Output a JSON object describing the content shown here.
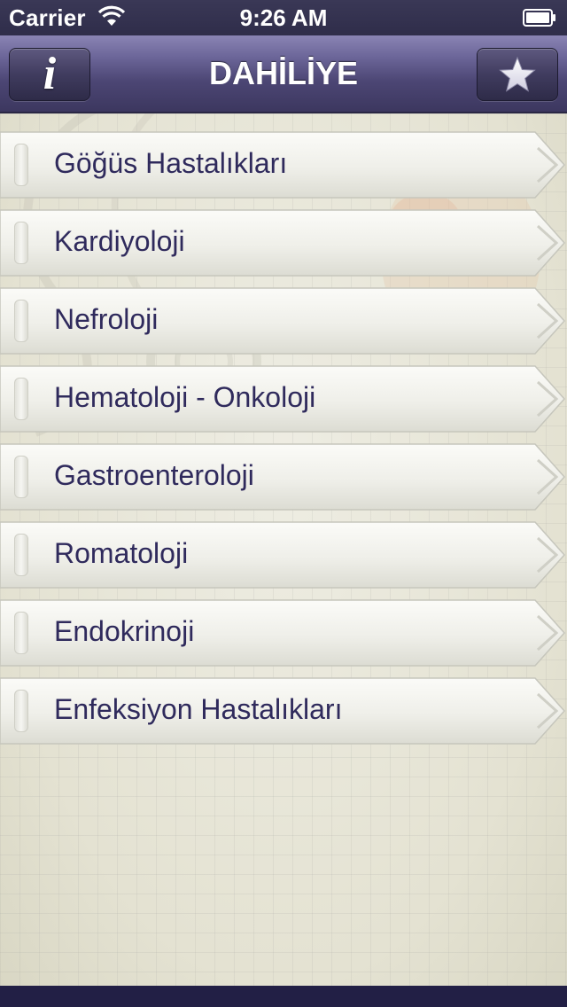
{
  "status_bar": {
    "carrier": "Carrier",
    "time": "9:26 AM",
    "wifi_icon": "wifi-icon",
    "battery_icon": "battery-icon"
  },
  "nav_bar": {
    "title": "DAHİLİYE",
    "info_button_glyph": "i",
    "info_icon": "info-icon",
    "favorites_icon": "star-icon"
  },
  "menu": {
    "items": [
      {
        "label": "Göğüs Hastalıkları"
      },
      {
        "label": "Kardiyoloji"
      },
      {
        "label": "Nefroloji"
      },
      {
        "label": "Hematoloji - Onkoloji"
      },
      {
        "label": "Gastroenteroloji"
      },
      {
        "label": "Romatoloji"
      },
      {
        "label": "Endokrinoji"
      },
      {
        "label": "Enfeksiyon Hastalıkları"
      }
    ],
    "item_icon": "chevron-right-icon"
  },
  "colors": {
    "nav_bar": "#5a5484",
    "label_text": "#2f2a5c",
    "bottom_bar": "#221f45"
  }
}
